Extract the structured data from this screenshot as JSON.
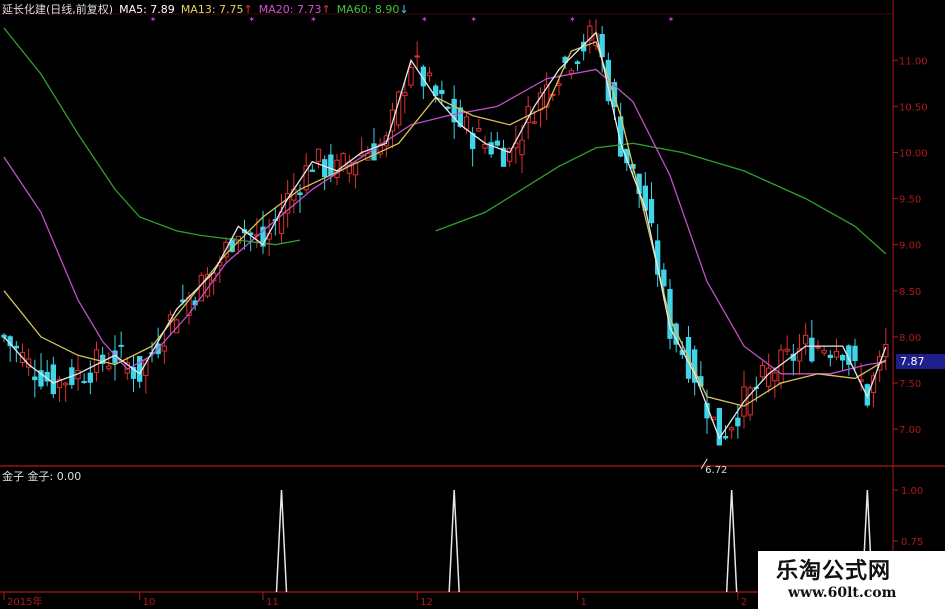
{
  "header": {
    "stock": "延长化建(日线,前复权)",
    "ma5": "MA5: 7.89",
    "ma13": "MA13: 7.75",
    "ma20": "MA20: 7.73",
    "ma60": "MA60: 8.90",
    "arrow_up": "↑",
    "arrow_down": "↓"
  },
  "indicator": {
    "label": "金子  金子: 0.00"
  },
  "price_tag": "7.87",
  "low_marker": "6.72",
  "watermark": {
    "line1": "乐淘公式网",
    "line2": "www.60lt.com"
  },
  "colors": {
    "background": "#000000",
    "frame": "#b01818",
    "up": "#e03030",
    "down": "#3fd4e8",
    "ma5": "#e8e8e8",
    "ma13": "#d8c45a",
    "ma20": "#c050c8",
    "ma60": "#2fa02f",
    "signal": "#e8e8e8"
  },
  "chart_data": [
    {
      "type": "candlestick",
      "y_axis_side": "right",
      "ylim": [
        6.6,
        11.35
      ],
      "yticks": [
        7.0,
        7.5,
        8.0,
        8.5,
        9.0,
        9.5,
        10.0,
        10.5,
        11.0
      ],
      "ytick_labels": [
        "7.00",
        "7.50",
        "8.00",
        "8.50",
        "9.00",
        "9.50",
        "10.00",
        "10.50",
        "11.00"
      ],
      "x_labels": [
        "2015年",
        "10",
        "11",
        "12",
        "1",
        "2"
      ],
      "x_label_index": [
        0,
        22,
        42,
        67,
        93,
        119
      ],
      "annotations": [
        {
          "text": "6.72",
          "index": 115,
          "price": 6.72
        }
      ],
      "current_price": 7.87,
      "series_names": [
        "MA5",
        "MA13",
        "MA20",
        "MA60"
      ],
      "ma60_last": 8.9,
      "ma60_shape": [
        [
          0,
          11.35
        ],
        [
          6,
          10.85
        ],
        [
          12,
          10.2
        ],
        [
          18,
          9.6
        ],
        [
          22,
          9.3
        ],
        [
          28,
          9.15
        ],
        [
          32,
          9.1
        ],
        [
          38,
          9.05
        ],
        [
          44,
          9.0
        ],
        [
          48,
          9.05
        ]
      ],
      "ma60_segment2": [
        [
          70,
          9.15
        ],
        [
          78,
          9.35
        ],
        [
          84,
          9.6
        ],
        [
          90,
          9.85
        ],
        [
          96,
          10.05
        ],
        [
          102,
          10.1
        ],
        [
          110,
          10.0
        ],
        [
          120,
          9.8
        ],
        [
          130,
          9.5
        ],
        [
          138,
          9.2
        ],
        [
          143,
          8.9
        ]
      ],
      "ma20_shape": [
        [
          0,
          9.95
        ],
        [
          6,
          9.35
        ],
        [
          12,
          8.4
        ],
        [
          16,
          7.95
        ],
        [
          20,
          7.65
        ],
        [
          24,
          7.8
        ],
        [
          30,
          8.25
        ],
        [
          36,
          8.8
        ],
        [
          42,
          9.15
        ],
        [
          50,
          9.6
        ],
        [
          58,
          9.95
        ],
        [
          66,
          10.3
        ],
        [
          72,
          10.4
        ],
        [
          80,
          10.5
        ],
        [
          88,
          10.8
        ],
        [
          96,
          10.9
        ],
        [
          102,
          10.55
        ],
        [
          108,
          9.75
        ],
        [
          114,
          8.6
        ],
        [
          120,
          7.9
        ],
        [
          126,
          7.6
        ],
        [
          134,
          7.6
        ],
        [
          140,
          7.7
        ],
        [
          143,
          7.73
        ]
      ],
      "ma13_shape": [
        [
          0,
          8.5
        ],
        [
          6,
          8.0
        ],
        [
          12,
          7.8
        ],
        [
          18,
          7.7
        ],
        [
          24,
          7.9
        ],
        [
          30,
          8.4
        ],
        [
          36,
          8.9
        ],
        [
          42,
          9.3
        ],
        [
          48,
          9.6
        ],
        [
          56,
          9.85
        ],
        [
          64,
          10.1
        ],
        [
          70,
          10.6
        ],
        [
          76,
          10.4
        ],
        [
          82,
          10.3
        ],
        [
          88,
          10.5
        ],
        [
          92,
          11.1
        ],
        [
          96,
          11.2
        ],
        [
          100,
          10.4
        ],
        [
          104,
          9.3
        ],
        [
          108,
          8.2
        ],
        [
          114,
          7.35
        ],
        [
          120,
          7.25
        ],
        [
          126,
          7.5
        ],
        [
          132,
          7.6
        ],
        [
          138,
          7.55
        ],
        [
          143,
          7.75
        ]
      ],
      "ma5_shape": [
        [
          0,
          8.0
        ],
        [
          4,
          7.7
        ],
        [
          8,
          7.5
        ],
        [
          12,
          7.6
        ],
        [
          18,
          7.8
        ],
        [
          22,
          7.6
        ],
        [
          28,
          8.3
        ],
        [
          34,
          8.7
        ],
        [
          38,
          9.2
        ],
        [
          42,
          9.0
        ],
        [
          46,
          9.5
        ],
        [
          50,
          9.9
        ],
        [
          54,
          9.8
        ],
        [
          58,
          10.0
        ],
        [
          62,
          10.1
        ],
        [
          66,
          11.0
        ],
        [
          70,
          10.6
        ],
        [
          74,
          10.3
        ],
        [
          78,
          10.1
        ],
        [
          82,
          10.0
        ],
        [
          86,
          10.5
        ],
        [
          90,
          10.9
        ],
        [
          96,
          11.3
        ],
        [
          100,
          10.1
        ],
        [
          104,
          9.4
        ],
        [
          108,
          8.1
        ],
        [
          112,
          7.6
        ],
        [
          116,
          6.9
        ],
        [
          120,
          7.3
        ],
        [
          124,
          7.6
        ],
        [
          130,
          7.9
        ],
        [
          136,
          7.9
        ],
        [
          140,
          7.35
        ],
        [
          143,
          7.89
        ]
      ]
    },
    {
      "type": "line",
      "name": "金子",
      "ylim": [
        0.5,
        1.0
      ],
      "yticks": [
        0.5,
        0.75,
        1.0
      ],
      "ytick_labels": [
        "0.50",
        "0.75",
        "1.00"
      ],
      "signals_at_index": [
        45,
        73,
        118,
        140
      ],
      "signal_value": 1.0,
      "current_value": 0.0
    }
  ]
}
